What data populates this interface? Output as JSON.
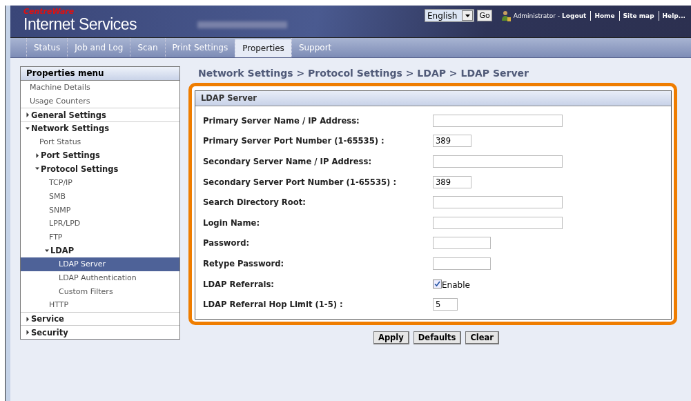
{
  "header": {
    "brand": "CentreWare",
    "product": "Internet Services",
    "language": "English",
    "go": "Go",
    "user": "Administrator -",
    "links": [
      "Logout",
      "Home",
      "Site map",
      "Help..."
    ]
  },
  "tabs": [
    {
      "label": "Status",
      "selected": false
    },
    {
      "label": "Job and Log",
      "selected": false
    },
    {
      "label": "Scan",
      "selected": false
    },
    {
      "label": "Print Settings",
      "selected": false
    },
    {
      "label": "Properties",
      "selected": true
    },
    {
      "label": "Support",
      "selected": false
    }
  ],
  "sidebar": {
    "title": "Properties menu",
    "items": [
      {
        "label": "Machine Details",
        "selected": false
      },
      {
        "label": "Usage Counters",
        "selected": false
      },
      {
        "label": "General Settings",
        "expanded": false
      },
      {
        "label": "Network Settings",
        "expanded": true,
        "children": [
          {
            "label": "Port Status",
            "selected": false
          },
          {
            "label": "Port Settings",
            "expanded": false
          },
          {
            "label": "Protocol Settings",
            "expanded": true,
            "children": [
              {
                "label": "TCP/IP",
                "selected": false
              },
              {
                "label": "SMB",
                "selected": false
              },
              {
                "label": "SNMP",
                "selected": false
              },
              {
                "label": "LPR/LPD",
                "selected": false
              },
              {
                "label": "FTP",
                "selected": false
              },
              {
                "label": "LDAP",
                "expanded": true,
                "children": [
                  {
                    "label": "LDAP Server",
                    "selected": true
                  },
                  {
                    "label": "LDAP Authentication",
                    "selected": false
                  },
                  {
                    "label": "Custom Filters",
                    "selected": false
                  }
                ]
              },
              {
                "label": "HTTP",
                "selected": false
              }
            ]
          }
        ]
      },
      {
        "label": "Service",
        "expanded": false
      },
      {
        "label": "Security",
        "expanded": false
      }
    ]
  },
  "breadcrumb": "Network Settings > Protocol Settings > LDAP > LDAP Server",
  "panel": {
    "title": "LDAP Server",
    "fields": [
      {
        "kind": "text",
        "label": "Primary Server Name / IP Address:"
      },
      {
        "kind": "port",
        "label": "Primary Server Port Number (1-65535) :",
        "value": "389"
      },
      {
        "kind": "text",
        "label": "Secondary Server Name / IP Address:"
      },
      {
        "kind": "port",
        "label": "Secondary Server Port Number (1-65535) :",
        "value": "389"
      },
      {
        "kind": "text",
        "label": "Search Directory Root:"
      },
      {
        "kind": "text",
        "label": "Login Name:"
      },
      {
        "kind": "password",
        "label": "Password:"
      },
      {
        "kind": "password",
        "label": "Retype Password:"
      },
      {
        "kind": "checkbox",
        "label": "LDAP Referrals:",
        "option": "Enable",
        "checked": true
      },
      {
        "kind": "small",
        "label": "LDAP Referral Hop Limit (1-5) :",
        "value": "5"
      }
    ]
  },
  "buttons": [
    "Apply",
    "Defaults",
    "Clear"
  ]
}
